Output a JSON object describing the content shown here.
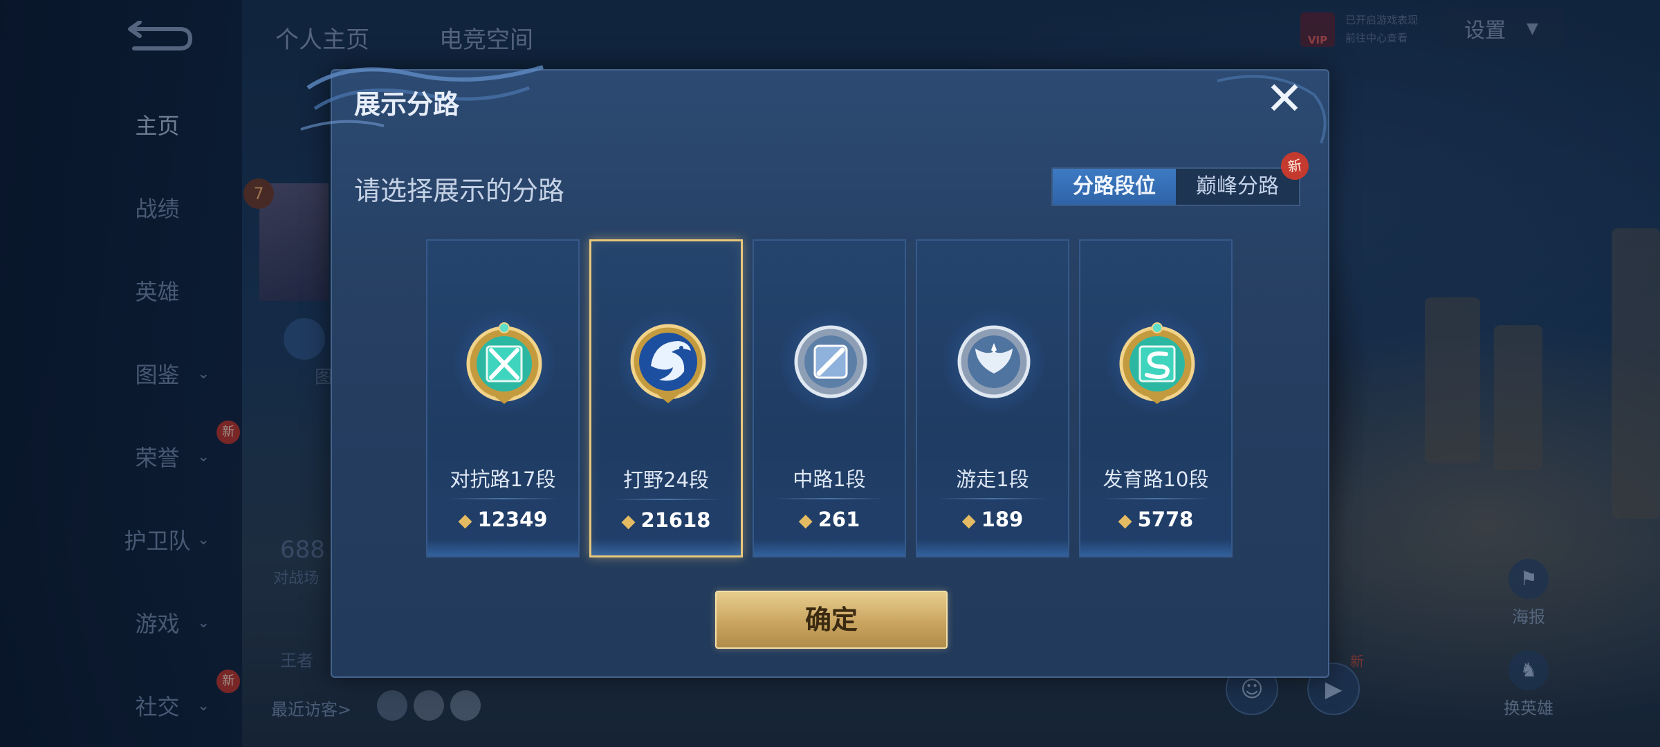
{
  "nav": {
    "items": [
      {
        "label": "主页",
        "active": true,
        "chevron": false,
        "badge": ""
      },
      {
        "label": "战绩",
        "active": false,
        "chevron": false,
        "badge": ""
      },
      {
        "label": "英雄",
        "active": false,
        "chevron": false,
        "badge": ""
      },
      {
        "label": "图鉴",
        "active": false,
        "chevron": true,
        "badge": ""
      },
      {
        "label": "荣誉",
        "active": false,
        "chevron": true,
        "badge": "新"
      },
      {
        "label": "护卫队",
        "active": false,
        "chevron": true,
        "badge": ""
      },
      {
        "label": "游戏",
        "active": false,
        "chevron": true,
        "badge": ""
      },
      {
        "label": "社交",
        "active": false,
        "chevron": true,
        "badge": "新"
      }
    ]
  },
  "top": {
    "tab_profile": "个人主页",
    "tab_esports": "电竞空间",
    "vip_badge": "VIP",
    "vip_line1": "已开启游戏表现",
    "vip_line2": "前往中心查看",
    "settings_label": "设置"
  },
  "background": {
    "level_badge": "7",
    "stat_value": "688",
    "stat_label": "对战场",
    "king_label": "王者",
    "recent_visitors": "最近访客>",
    "side_poster": "海报",
    "side_switch_hero": "换英雄",
    "side_new": "新",
    "gallery_short": "图"
  },
  "modal": {
    "title": "展示分路",
    "close_icon": "close-icon",
    "prompt": "请选择展示的分路",
    "tabs": [
      {
        "label": "分路段位",
        "active": true
      },
      {
        "label": "巅峰分路",
        "active": false,
        "badge": "新"
      }
    ],
    "lanes": [
      {
        "rank": "对抗路17段",
        "score": "12349",
        "emblem": "clash-lane-emblem",
        "tier": "gold",
        "selected": false
      },
      {
        "rank": "打野24段",
        "score": "21618",
        "emblem": "jungle-dragon-emblem",
        "tier": "gold",
        "selected": true
      },
      {
        "rank": "中路1段",
        "score": "261",
        "emblem": "mid-lane-emblem",
        "tier": "silver",
        "selected": false
      },
      {
        "rank": "游走1段",
        "score": "189",
        "emblem": "roam-wings-emblem",
        "tier": "silver",
        "selected": false
      },
      {
        "rank": "发育路10段",
        "score": "5778",
        "emblem": "farm-lane-emblem",
        "tier": "gold",
        "selected": false
      }
    ],
    "confirm_label": "确定"
  },
  "colors": {
    "modal_bg": "#2c4a72",
    "selected_border": "#e9c87b",
    "confirm_gold": "#c9a560",
    "tab_active": "#3d7ac3",
    "badge_red": "#c53a2f"
  }
}
